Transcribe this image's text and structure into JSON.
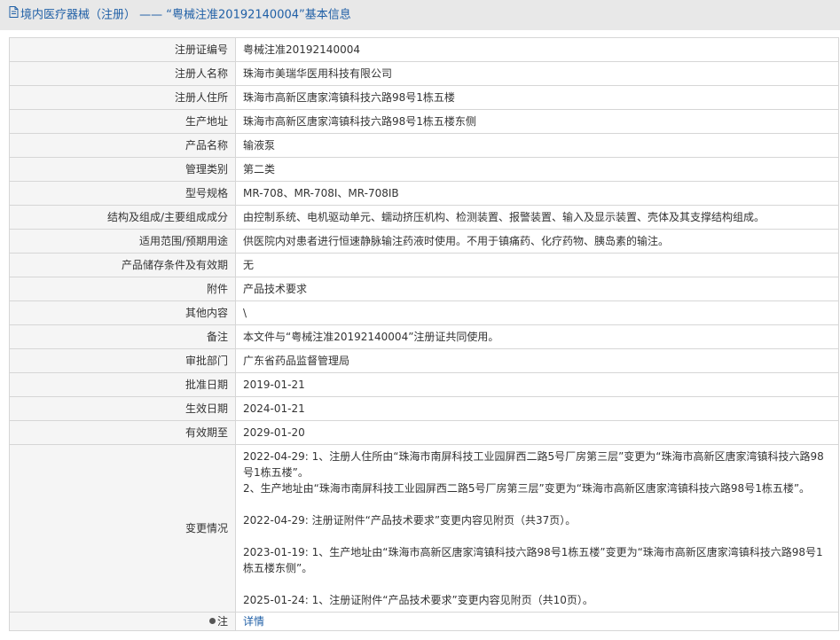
{
  "header": {
    "title_prefix": "境内医疗器械（注册）",
    "separator": "——",
    "title_reg": "“粤械注准20192140004”",
    "title_suffix": "基本信息",
    "icon": "document-icon"
  },
  "rows": [
    {
      "label": "注册证编号",
      "value": "粤械注准20192140004"
    },
    {
      "label": "注册人名称",
      "value": "珠海市美瑞华医用科技有限公司"
    },
    {
      "label": "注册人住所",
      "value": "珠海市高新区唐家湾镇科技六路98号1栋五楼"
    },
    {
      "label": "生产地址",
      "value": "珠海市高新区唐家湾镇科技六路98号1栋五楼东侧"
    },
    {
      "label": "产品名称",
      "value": "输液泵"
    },
    {
      "label": "管理类别",
      "value": "第二类"
    },
    {
      "label": "型号规格",
      "value": "MR-708、MR-708I、MR-708IB"
    },
    {
      "label": "结构及组成/主要组成成分",
      "value": "由控制系统、电机驱动单元、蠕动挤压机构、检测装置、报警装置、输入及显示装置、壳体及其支撑结构组成。"
    },
    {
      "label": "适用范围/预期用途",
      "value": "供医院内对患者进行恒速静脉输注药液时使用。不用于镇痛药、化疗药物、胰岛素的输注。"
    },
    {
      "label": "产品储存条件及有效期",
      "value": "无"
    },
    {
      "label": "附件",
      "value": "产品技术要求"
    },
    {
      "label": "其他内容",
      "value": "\\"
    },
    {
      "label": "备注",
      "value": "本文件与“粤械注准20192140004”注册证共同使用。"
    },
    {
      "label": "审批部门",
      "value": "广东省药品监督管理局"
    },
    {
      "label": "批准日期",
      "value": "2019-01-21"
    },
    {
      "label": "生效日期",
      "value": "2024-01-21"
    },
    {
      "label": "有效期至",
      "value": "2029-01-20"
    }
  ],
  "changes": {
    "label": "变更情况",
    "entries": [
      [
        "2022-04-29: 1、注册人住所由“珠海市南屏科技工业园屏西二路5号厂房第三层”变更为“珠海市高新区唐家湾镇科技六路98号1栋五楼”。",
        "2、生产地址由“珠海市南屏科技工业园屏西二路5号厂房第三层”变更为“珠海市高新区唐家湾镇科技六路98号1栋五楼”。"
      ],
      [
        "2022-04-29: 注册证附件“产品技术要求”变更内容见附页（共37页）。"
      ],
      [
        "2023-01-19: 1、生产地址由“珠海市高新区唐家湾镇科技六路98号1栋五楼”变更为“珠海市高新区唐家湾镇科技六路98号1栋五楼东侧”。"
      ],
      [
        "2025-01-24: 1、注册证附件“产品技术要求”变更内容见附页（共10页）。"
      ]
    ]
  },
  "note": {
    "label": "注",
    "link": "详情"
  }
}
